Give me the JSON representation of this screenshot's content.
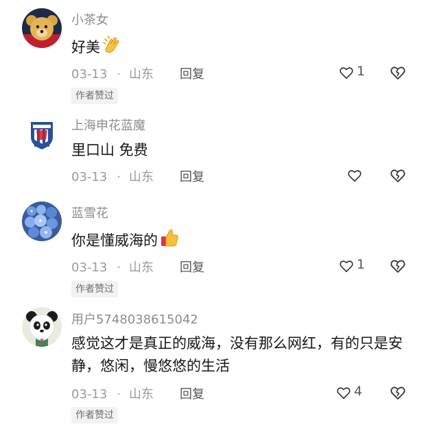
{
  "comments": [
    {
      "username": "小茶女",
      "text": "好美",
      "emoji": "clapping-hands-emoji",
      "date": "03-13",
      "separator": "·",
      "location": "山东",
      "reply_label": "回复",
      "like_count": "1",
      "badge": "作者赞过"
    },
    {
      "username": "上海申花蓝魔",
      "text": "里口山 免费",
      "date": "03-13",
      "separator": "·",
      "location": "山东",
      "reply_label": "回复",
      "like_count": ""
    },
    {
      "username": "蓝雪花",
      "text": "你是懂威海的",
      "emoji": "thumbs-up-emoji",
      "date": "03-13",
      "separator": "·",
      "location": "山东",
      "reply_label": "回复",
      "like_count": "1",
      "badge": "作者赞过"
    },
    {
      "username": "用户5748038615042",
      "text": "感觉这才是真正的威海，没有那么网红，有的只是安静，悠闲，慢悠悠的生活",
      "date": "03-13",
      "separator": "·",
      "location": "山东",
      "reply_label": "回复",
      "like_count": "4",
      "badge": "作者赞过"
    }
  ],
  "colors": {
    "username": "#8c8c8c",
    "text": "#161616",
    "meta": "#9a9a9a",
    "badge_bg": "#f2f2f2"
  }
}
